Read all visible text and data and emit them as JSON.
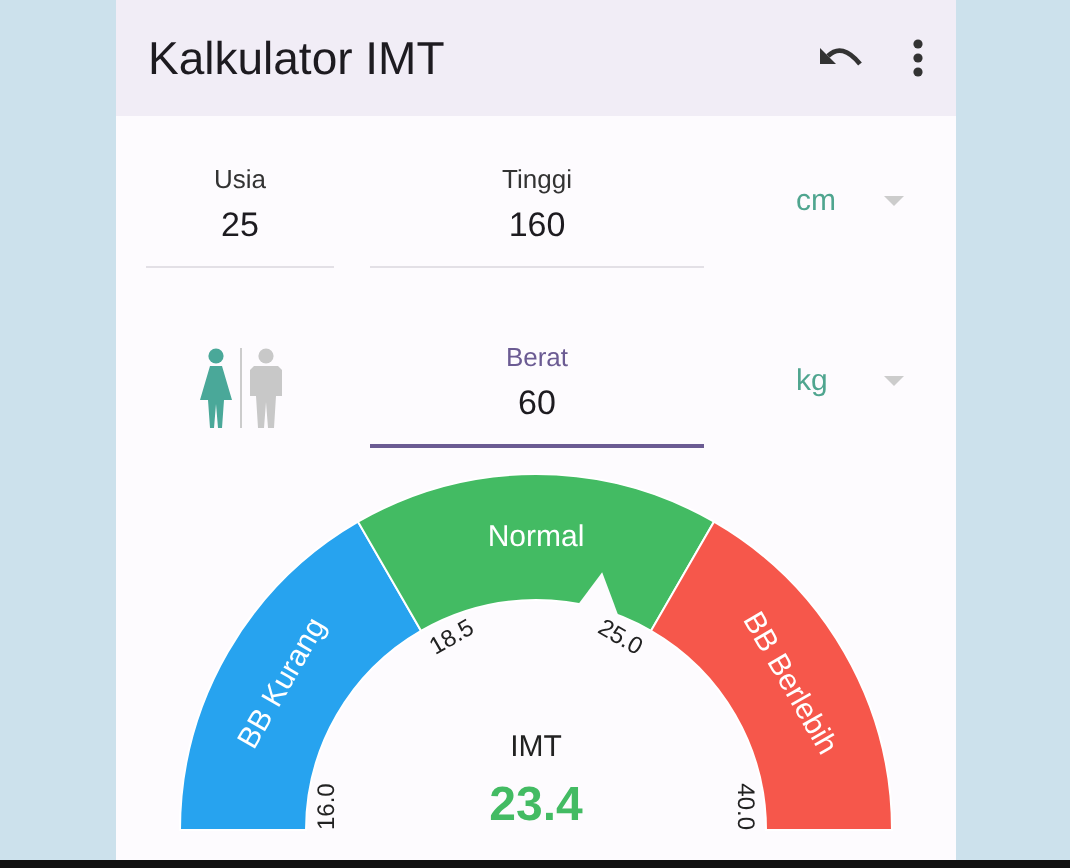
{
  "app_bar": {
    "title": "Kalkulator IMT"
  },
  "fields": [
    {
      "label": "Usia",
      "value": "25",
      "focused": false
    },
    {
      "label": "Tinggi",
      "value": "160",
      "focused": false,
      "unit": "cm"
    },
    {
      "label": "Berat",
      "value": "60",
      "focused": true,
      "unit": "kg"
    }
  ],
  "gender": [
    {
      "kind": "female",
      "selected": true
    },
    {
      "kind": "male",
      "selected": false
    }
  ],
  "gauge": {
    "segments": [
      {
        "label": "BB Kurang",
        "color": "#27a3ef"
      },
      {
        "label": "Normal",
        "color": "#43bb63"
      },
      {
        "label": "BB Berlebih",
        "color": "#f6574b"
      }
    ],
    "ticks": [
      "16.0",
      "18.5",
      "25.0",
      "40.0"
    ],
    "value_label": "IMT",
    "value": "23.4"
  }
}
